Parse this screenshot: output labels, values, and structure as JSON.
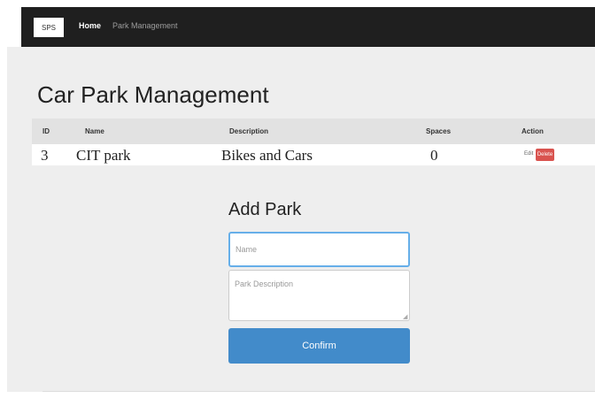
{
  "navbar": {
    "brand": "SPS",
    "links": [
      {
        "label": "Home",
        "active": true
      },
      {
        "label": "Park Management",
        "active": false
      }
    ],
    "bg_color": "#1f1f1f"
  },
  "page": {
    "title": "Car Park Management"
  },
  "table": {
    "headers": [
      "ID",
      "Name",
      "Description",
      "Spaces",
      "Action"
    ],
    "rows": [
      {
        "id": "3",
        "name": "CIT park",
        "description": "Bikes and Cars",
        "spaces": "0",
        "edit_label": "Edit",
        "delete_label": "Delete"
      }
    ]
  },
  "form": {
    "title": "Add Park",
    "name_placeholder": "Name",
    "description_placeholder": "Park Description",
    "confirm_label": "Confirm",
    "focus_color": "#66afe9",
    "confirm_color": "#428bca",
    "delete_color": "#d9534f"
  },
  "icons": {
    "resize": "resize-grip-icon"
  }
}
